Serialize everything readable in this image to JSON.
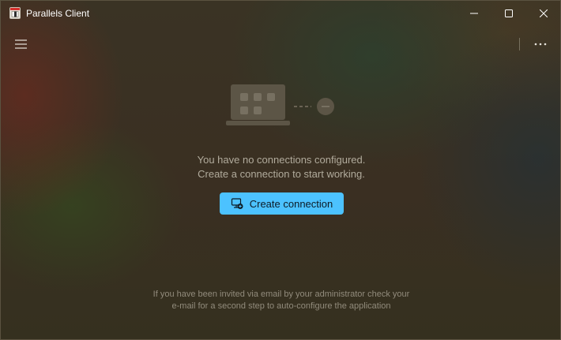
{
  "window": {
    "title": "Parallels Client"
  },
  "toolbar": {
    "menu_icon": "hamburger-icon",
    "more_icon": "more-horizontal-icon"
  },
  "empty_state": {
    "line1": "You have no connections configured.",
    "line2": "Create a connection to start working.",
    "create_button_label": "Create connection"
  },
  "footer": {
    "line1": "If you have been invited via email by your administrator check your",
    "line2": "e-mail for a second step to auto-configure the application"
  },
  "colors": {
    "accent": "#4cc2ff",
    "text_primary": "#ffffff",
    "text_muted": "#b1ab9c"
  }
}
